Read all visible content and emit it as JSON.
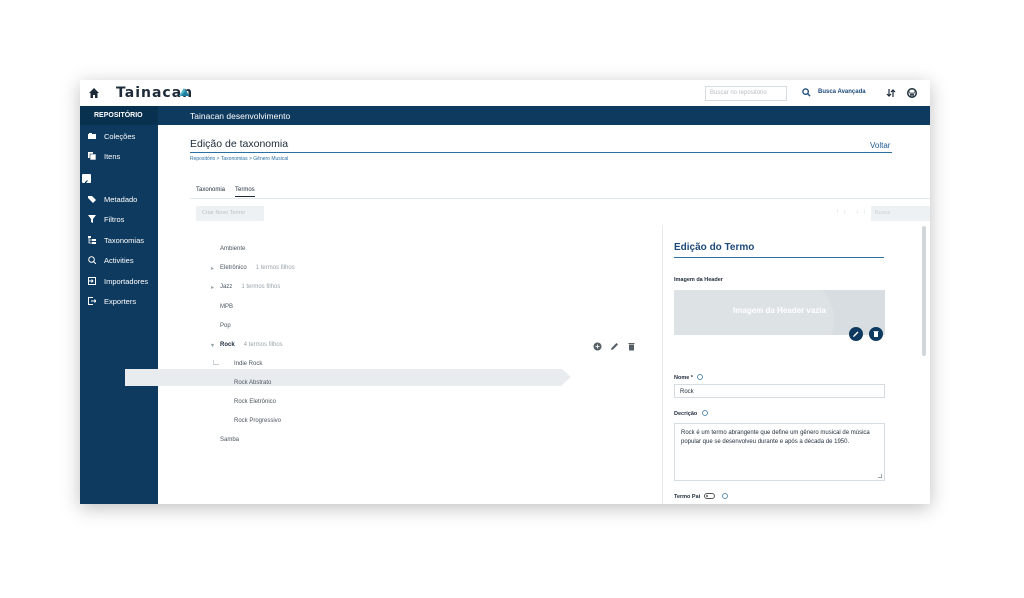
{
  "app": {
    "logo_text": "Tainacan",
    "search_placeholder": "Buscar no repositório",
    "advanced_search_label": "Busca Avançada"
  },
  "sidebar": {
    "heading": "REPOSITÓRIO",
    "items": [
      {
        "label": "Coleções",
        "icon": "collections-icon"
      },
      {
        "label": "Itens",
        "icon": "items-icon"
      },
      {
        "label": "Metadado",
        "icon": "tag-icon"
      },
      {
        "label": "Filtros",
        "icon": "filter-icon"
      },
      {
        "label": "Taxonomias",
        "icon": "taxonomy-icon"
      },
      {
        "label": "Activities",
        "icon": "activities-icon"
      },
      {
        "label": "Importadores",
        "icon": "import-icon"
      },
      {
        "label": "Exporters",
        "icon": "export-icon"
      }
    ]
  },
  "header": {
    "repository_name": "Tainacan desenvolvimento"
  },
  "page": {
    "title": "Edição de taxonomia",
    "back_label": "Voltar",
    "breadcrumb": "Repositório > Taxonomias > Gênero Musical",
    "tabs": [
      {
        "label": "Taxonomia",
        "active": false
      },
      {
        "label": "Termos",
        "active": true
      }
    ],
    "create_button": "Criar Novo Termo",
    "term_search_placeholder": "Busca",
    "sort_icons": "↑↓ ↓↓"
  },
  "terms": [
    {
      "name": "Ambiente",
      "children_label": "",
      "expandable": false,
      "level": 0
    },
    {
      "name": "Eletrônico",
      "children_label": "1 termos filhos",
      "expandable": true,
      "level": 0
    },
    {
      "name": "Jazz",
      "children_label": "1 termos filhos",
      "expandable": true,
      "level": 0
    },
    {
      "name": "MPB",
      "children_label": "",
      "expandable": false,
      "level": 0
    },
    {
      "name": "Pop",
      "children_label": "",
      "expandable": false,
      "level": 0
    },
    {
      "name": "Rock",
      "children_label": "4 termos filhos",
      "expandable": true,
      "level": 0,
      "selected": true
    },
    {
      "name": "Indie Rock",
      "children_label": "",
      "expandable": false,
      "level": 1
    },
    {
      "name": "Rock Abstrato",
      "children_label": "",
      "expandable": false,
      "level": 1
    },
    {
      "name": "Rock Eletrônico",
      "children_label": "",
      "expandable": false,
      "level": 1
    },
    {
      "name": "Rock Progressivo",
      "children_label": "",
      "expandable": false,
      "level": 1
    },
    {
      "name": "Samba",
      "children_label": "",
      "expandable": false,
      "level": 0
    }
  ],
  "edit_term": {
    "title": "Edição do Termo",
    "header_image_label": "Imagem da Header",
    "header_image_empty": "Imagem da Header vazia",
    "name_label": "Nome *",
    "name_value": "Rock",
    "description_label": "Decrição",
    "description_value": "Rock é um termo abrangente que define um gênero musical de música popular que se desenvolveu durante e após a década de 1950.",
    "parent_label": "Termo Pai"
  },
  "colors": {
    "primary_dark": "#0e3a5f",
    "accent": "#2b6fa3"
  }
}
